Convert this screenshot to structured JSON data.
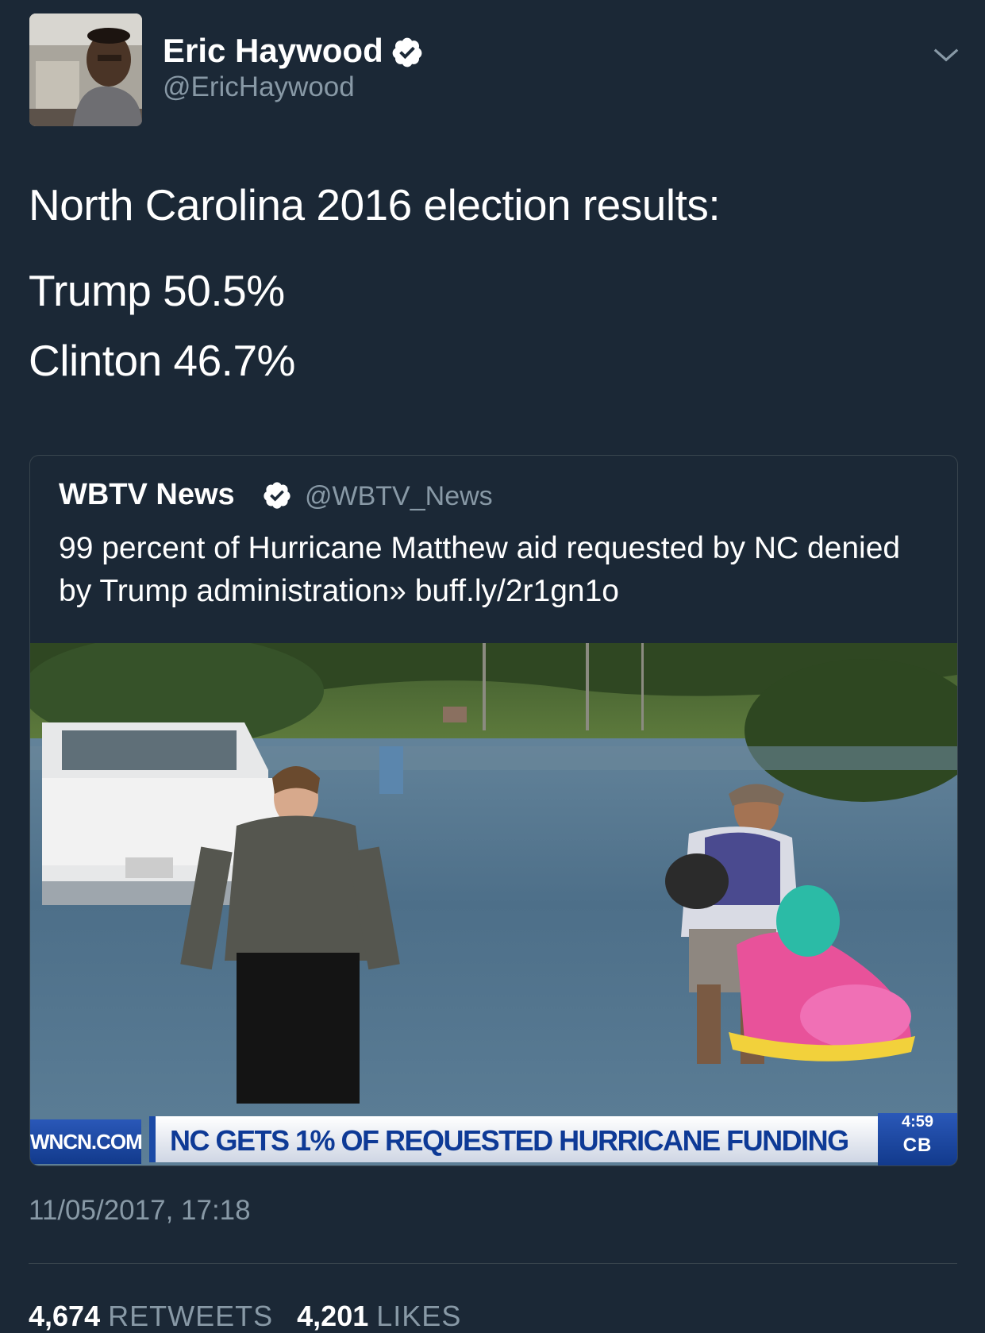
{
  "author": {
    "name": "Eric Haywood",
    "handle": "@EricHaywood"
  },
  "tweet": {
    "lines": [
      "North Carolina 2016 election results:",
      "Trump 50.5%",
      "Clinton 46.7%"
    ]
  },
  "quoted": {
    "name": "WBTV News",
    "handle": "@WBTV_News",
    "text": "99 percent of Hurricane Matthew aid requested by NC denied by Trump administration» buff.ly/2r1gn1o",
    "media": {
      "station_logo": "WNCN.COM",
      "headline": "NC GETS 1% OF REQUESTED HURRICANE FUNDING",
      "clock": "4:59",
      "network": "CB"
    }
  },
  "timestamp": "11/05/2017, 17:18",
  "stats": {
    "retweets_count": "4,674",
    "retweets_label": "RETWEETS",
    "likes_count": "4,201",
    "likes_label": "LIKES"
  },
  "colors": {
    "background": "#1b2836",
    "secondary_text": "#8899a6",
    "verified": "#ffffff"
  },
  "icons": [
    "verified-badge-icon",
    "chevron-down-icon"
  ]
}
